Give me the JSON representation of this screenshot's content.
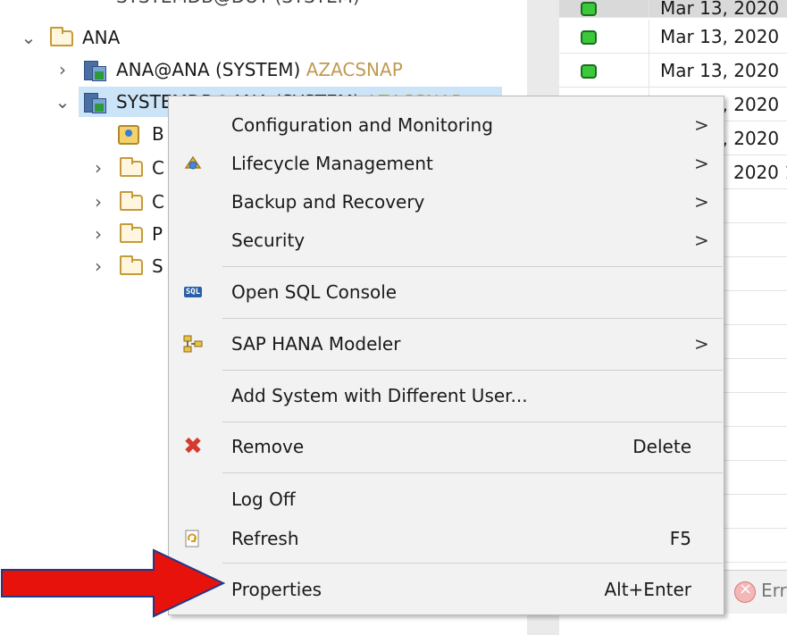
{
  "tree": {
    "top_item_partial": "SYSTEMDB@DUT (SYSTEM)",
    "folder_ana": "ANA",
    "sys_ana": {
      "label": "ANA@ANA (SYSTEM)",
      "accent": "AZACSNAP"
    },
    "sys_systemdb": {
      "label": "SYSTEMDB@ANA (SYSTEM)",
      "accent": "AZACSNAP"
    },
    "children": [
      {
        "label": "B",
        "icon": "backup-icon"
      },
      {
        "label": "C",
        "icon": "folder-icon"
      },
      {
        "label": "C",
        "icon": "folder-icon"
      },
      {
        "label": "P",
        "icon": "folder-icon"
      },
      {
        "label": "S",
        "icon": "folder-icon"
      }
    ]
  },
  "table": {
    "rows": [
      {
        "status": "green",
        "date": "Mar 13, 2020"
      },
      {
        "status": "green",
        "date": "Mar 13, 2020"
      },
      {
        "status": "green",
        "date": "Mar 13, 2020"
      },
      {
        "status": "grey",
        "date": "Mar 13, 2020"
      },
      {
        "status": "grey",
        "date": "Mar 13, 2020"
      },
      {
        "status": "grey",
        "date": "2020 1"
      }
    ],
    "error_label": "Err"
  },
  "menu": {
    "configuration": "Configuration and Monitoring",
    "lifecycle": "Lifecycle Management",
    "backup": "Backup and Recovery",
    "security": "Security",
    "open_sql": "Open SQL Console",
    "modeler": "SAP HANA Modeler",
    "add_system": "Add System with Different User...",
    "remove": "Remove",
    "remove_shortcut": "Delete",
    "log_off": "Log Off",
    "refresh": "Refresh",
    "refresh_shortcut": "F5",
    "properties": "Properties",
    "properties_shortcut": "Alt+Enter",
    "submenu_arrow": ">",
    "sql_icon_text": "SQL"
  },
  "colors": {
    "accent": "#c09a52",
    "selection": "#cce4f7",
    "status_green": "#3cc83c",
    "arrow_red": "#e8120c",
    "arrow_border": "#1f3a8a"
  }
}
